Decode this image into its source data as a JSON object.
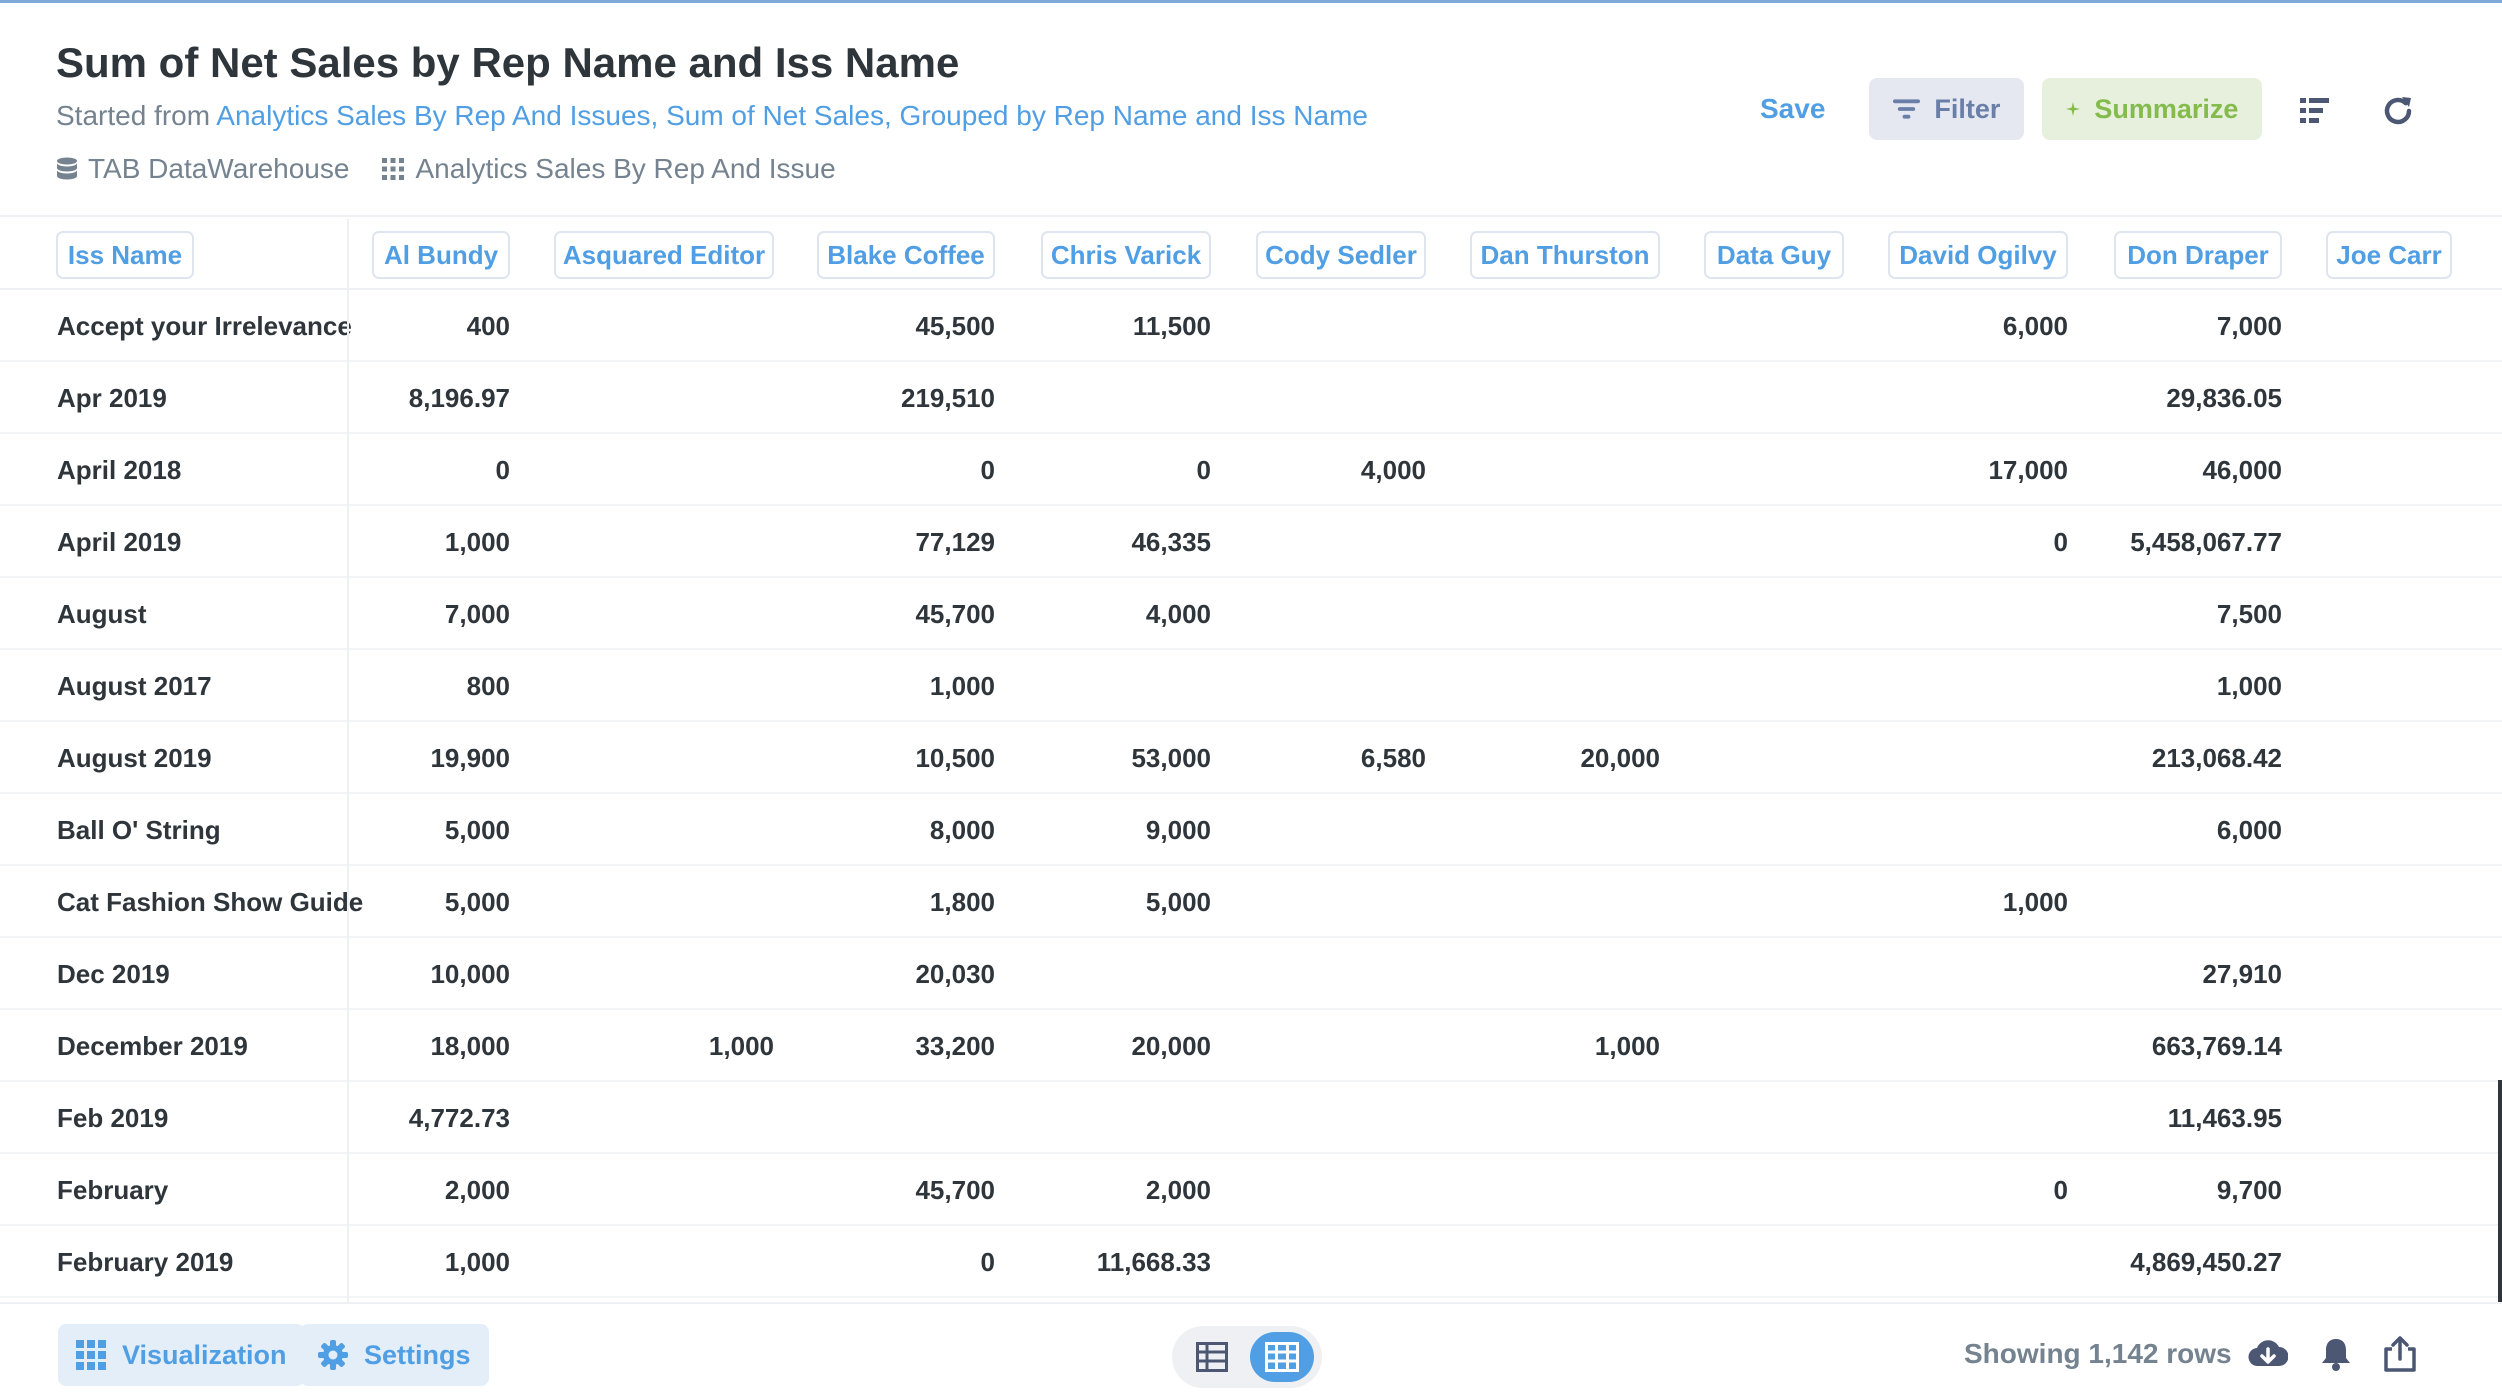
{
  "header": {
    "title": "Sum of Net Sales by Rep Name and Iss Name",
    "subtitle_prefix": "Started from ",
    "subtitle_link": "Analytics Sales By Rep And Issues, Sum of Net Sales, Grouped by Rep Name and Iss Name",
    "database": "TAB DataWarehouse",
    "table": "Analytics Sales By Rep And Issue",
    "save_label": "Save",
    "filter_label": "Filter",
    "summarize_label": "Summarize"
  },
  "columns": [
    "Iss Name",
    "Al Bundy",
    "Asquared Editor",
    "Blake Coffee",
    "Chris Varick",
    "Cody Sedler",
    "Dan Thurston",
    "Data Guy",
    "David Ogilvy",
    "Don Draper",
    "Joe Carr"
  ],
  "rows": [
    {
      "name": "Accept your Irrelevance",
      "values": [
        "400",
        "",
        "45,500",
        "11,500",
        "",
        "",
        "",
        "6,000",
        "7,000",
        ""
      ]
    },
    {
      "name": "Apr 2019",
      "values": [
        "8,196.97",
        "",
        "219,510",
        "",
        "",
        "",
        "",
        "",
        "29,836.05",
        ""
      ]
    },
    {
      "name": "April 2018",
      "values": [
        "0",
        "",
        "0",
        "0",
        "4,000",
        "",
        "",
        "17,000",
        "46,000",
        ""
      ]
    },
    {
      "name": "April 2019",
      "values": [
        "1,000",
        "",
        "77,129",
        "46,335",
        "",
        "",
        "",
        "0",
        "5,458,067.77",
        ""
      ]
    },
    {
      "name": "August",
      "values": [
        "7,000",
        "",
        "45,700",
        "4,000",
        "",
        "",
        "",
        "",
        "7,500",
        ""
      ]
    },
    {
      "name": "August 2017",
      "values": [
        "800",
        "",
        "1,000",
        "",
        "",
        "",
        "",
        "",
        "1,000",
        ""
      ]
    },
    {
      "name": "August 2019",
      "values": [
        "19,900",
        "",
        "10,500",
        "53,000",
        "6,580",
        "20,000",
        "",
        "",
        "213,068.42",
        ""
      ]
    },
    {
      "name": "Ball O' String",
      "values": [
        "5,000",
        "",
        "8,000",
        "9,000",
        "",
        "",
        "",
        "",
        "6,000",
        ""
      ]
    },
    {
      "name": "Cat Fashion Show Guide",
      "values": [
        "5,000",
        "",
        "1,800",
        "5,000",
        "",
        "",
        "",
        "1,000",
        "",
        ""
      ]
    },
    {
      "name": "Dec 2019",
      "values": [
        "10,000",
        "",
        "20,030",
        "",
        "",
        "",
        "",
        "",
        "27,910",
        ""
      ]
    },
    {
      "name": "December 2019",
      "values": [
        "18,000",
        "1,000",
        "33,200",
        "20,000",
        "",
        "1,000",
        "",
        "",
        "663,769.14",
        ""
      ]
    },
    {
      "name": "Feb 2019",
      "values": [
        "4,772.73",
        "",
        "",
        "",
        "",
        "",
        "",
        "",
        "11,463.95",
        ""
      ]
    },
    {
      "name": "February",
      "values": [
        "2,000",
        "",
        "45,700",
        "2,000",
        "",
        "",
        "",
        "0",
        "9,700",
        ""
      ]
    },
    {
      "name": "February 2019",
      "values": [
        "1,000",
        "",
        "0",
        "11,668.33",
        "",
        "",
        "",
        "",
        "4,869,450.27",
        ""
      ]
    }
  ],
  "footer": {
    "visualization_label": "Visualization",
    "settings_label": "Settings",
    "row_count": "Showing 1,142 rows"
  },
  "colors": {
    "accent": "#509ee3",
    "summarize": "#84bb4c",
    "text": "#2e353b",
    "muted": "#74838f"
  }
}
